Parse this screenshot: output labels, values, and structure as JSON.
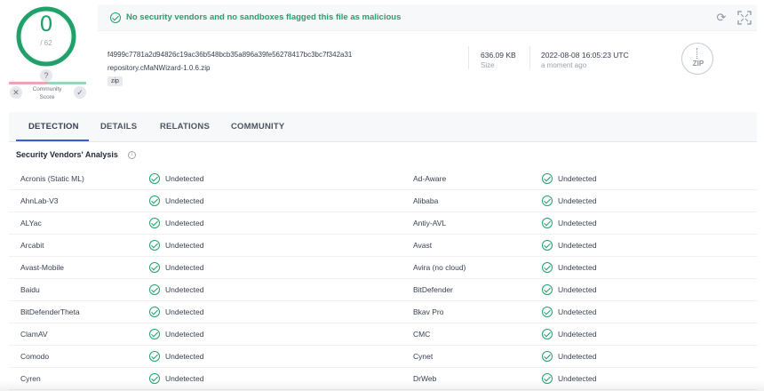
{
  "score": {
    "detections": "0",
    "total": "/ 62",
    "help_glyph": "?",
    "community_label": "Community Score",
    "vote_down_glyph": "✕",
    "vote_up_glyph": "✓",
    "ring_color": "#22a06b"
  },
  "banner": {
    "message": "No security vendors and no sandboxes flagged this file as malicious",
    "reload_glyph": "⟳",
    "status_color": "#22a06b"
  },
  "file": {
    "hash": "f4999c7781a2d94826c19ac36b548bcb35a896a39fe56278417bc3bc7f342a31",
    "name": "repository.cMaNWizard-1.0.6.zip",
    "tag": "zip",
    "size_value": "636.09 KB",
    "size_label": "Size",
    "date_value": "2022-08-08 16:05:23 UTC",
    "date_label": "a moment ago",
    "type_icon_label": "ZIP"
  },
  "tabs": [
    {
      "label": "DETECTION"
    },
    {
      "label": "DETAILS"
    },
    {
      "label": "RELATIONS"
    },
    {
      "label": "COMMUNITY"
    }
  ],
  "section": {
    "title": "Security Vendors' Analysis",
    "info_glyph": "i"
  },
  "vendors": [
    {
      "left": "Acronis (Static ML)",
      "left_status": "Undetected",
      "right": "Ad-Aware",
      "right_status": "Undetected"
    },
    {
      "left": "AhnLab-V3",
      "left_status": "Undetected",
      "right": "Alibaba",
      "right_status": "Undetected"
    },
    {
      "left": "ALYac",
      "left_status": "Undetected",
      "right": "Antiy-AVL",
      "right_status": "Undetected"
    },
    {
      "left": "Arcabit",
      "left_status": "Undetected",
      "right": "Avast",
      "right_status": "Undetected"
    },
    {
      "left": "Avast-Mobile",
      "left_status": "Undetected",
      "right": "Avira (no cloud)",
      "right_status": "Undetected"
    },
    {
      "left": "Baidu",
      "left_status": "Undetected",
      "right": "BitDefender",
      "right_status": "Undetected"
    },
    {
      "left": "BitDefenderTheta",
      "left_status": "Undetected",
      "right": "Bkav Pro",
      "right_status": "Undetected"
    },
    {
      "left": "ClamAV",
      "left_status": "Undetected",
      "right": "CMC",
      "right_status": "Undetected"
    },
    {
      "left": "Comodo",
      "left_status": "Undetected",
      "right": "Cynet",
      "right_status": "Undetected"
    },
    {
      "left": "Cyren",
      "left_status": "Undetected",
      "right": "DrWeb",
      "right_status": "Undetected"
    }
  ]
}
